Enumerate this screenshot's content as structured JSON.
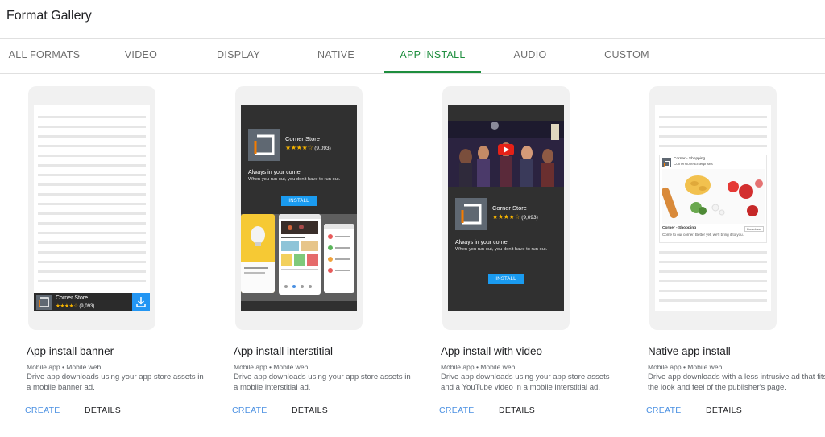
{
  "app": {
    "title": "Format Gallery"
  },
  "tabs": [
    {
      "label": "ALL FORMATS",
      "active": false
    },
    {
      "label": "VIDEO",
      "active": false
    },
    {
      "label": "DISPLAY",
      "active": false
    },
    {
      "label": "NATIVE",
      "active": false
    },
    {
      "label": "APP INSTALL",
      "active": true
    },
    {
      "label": "AUDIO",
      "active": false
    },
    {
      "label": "CUSTOM",
      "active": false
    }
  ],
  "cards": [
    {
      "title": "App install banner",
      "platforms": "Mobile app • Mobile web",
      "description": "Drive app downloads using your app store assets in a mobile banner ad.",
      "create_label": "CREATE",
      "details_label": "DETAILS",
      "preview": {
        "app_name": "Corner Store",
        "stars": "★★★★☆",
        "rating_count": "(9,093)"
      }
    },
    {
      "title": "App install interstitial",
      "platforms": "Mobile app • Mobile web",
      "description": "Drive app downloads using your app store assets in a mobile interstitial ad.",
      "create_label": "CREATE",
      "details_label": "DETAILS",
      "preview": {
        "app_name": "Corner Store",
        "stars": "★★★★☆",
        "rating_count": "(9,093)",
        "tagline": "Always in your corner",
        "subline": "When you run out, you don't have to run out.",
        "install_label": "INSTALL"
      }
    },
    {
      "title": "App install with video",
      "platforms": "Mobile app • Mobile web",
      "description": "Drive app downloads using your app store assets and a YouTube video in a mobile interstitial ad.",
      "create_label": "CREATE",
      "details_label": "DETAILS",
      "preview": {
        "app_name": "Corner Store",
        "stars": "★★★★☆",
        "rating_count": "(9,093)",
        "tagline": "Always in your corner",
        "subline": "When you run out, you don't have to run out.",
        "install_label": "INSTALL"
      }
    },
    {
      "title": "Native app install",
      "platforms": "Mobile app • Mobile web",
      "description": "Drive app downloads with a less intrusive ad that fits the look and feel of the publisher's page.",
      "create_label": "CREATE",
      "details_label": "DETAILS",
      "preview": {
        "app_name": "Corner - Shopping",
        "developer": "Cornerstone Enterprises",
        "caption_title": "Corner - Shopping",
        "caption_text": "Come to our corner. Better yet, we'll bring it to you.",
        "download_label": "Download"
      }
    }
  ],
  "colors": {
    "accent": "#1e8e3e",
    "link": "#4a90e2",
    "install": "#1a9bf0",
    "star": "#f6b400"
  }
}
